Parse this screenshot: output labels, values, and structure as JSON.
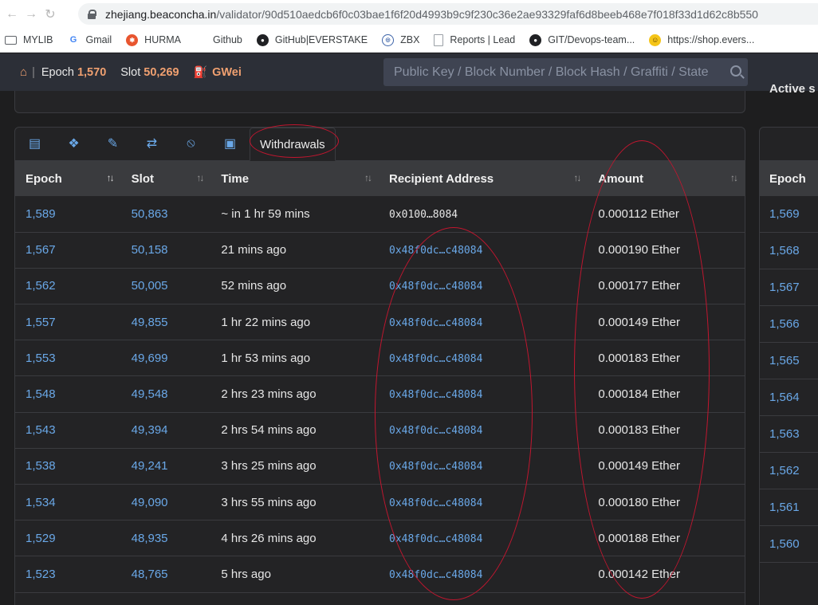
{
  "browser": {
    "url_host": "zhejiang.beaconcha.in",
    "url_path": "/validator/90d510aedcb6f0c03bae1f6f20d4993b9c9f230c36e2ae93329faf6d8beeb468e7f018f33d1d62c8b550"
  },
  "bookmarks": [
    {
      "label": "MYLIB",
      "icon": "folder-icon"
    },
    {
      "label": "Gmail",
      "icon": "google-icon"
    },
    {
      "label": "HURMA",
      "icon": "hurma-icon"
    },
    {
      "label": "Github",
      "icon": "none"
    },
    {
      "label": "GitHub|EVERSTAKE",
      "icon": "github-icon"
    },
    {
      "label": "ZBX",
      "icon": "zabbix-icon"
    },
    {
      "label": "Reports | Lead",
      "icon": "document-icon"
    },
    {
      "label": "GIT/Devops-team...",
      "icon": "github-icon"
    },
    {
      "label": "https://shop.evers...",
      "icon": "smiley-icon"
    }
  ],
  "navbar": {
    "epoch_label": "Epoch",
    "epoch_value": "1,570",
    "slot_label": "Slot",
    "slot_value": "50,269",
    "gas_label": "GWei",
    "search_placeholder": "Public Key / Block Number / Block Hash / Graffiti / State"
  },
  "right_panel": {
    "top_text": "Active s",
    "header": "Epoch",
    "epochs": [
      "1,569",
      "1,568",
      "1,567",
      "1,566",
      "1,565",
      "1,564",
      "1,563",
      "1,562",
      "1,561",
      "1,560"
    ]
  },
  "tabs": {
    "icons": [
      "bar-chart-icon",
      "cubes-icon",
      "chart-edit-icon",
      "sync-icon",
      "user-slash-icon",
      "wallet-icon"
    ],
    "active_label": "Withdrawals"
  },
  "table": {
    "columns": [
      "Epoch",
      "Slot",
      "Time",
      "Recipient Address",
      "Amount"
    ],
    "rows": [
      {
        "epoch": "1,589",
        "slot": "50,863",
        "time": "~ in 1 hr 59 mins",
        "address": "0x0100…8084",
        "amount": "0.000112 Ether"
      },
      {
        "epoch": "1,567",
        "slot": "50,158",
        "time": "21 mins ago",
        "address": "0x48f0dc…c48084",
        "amount": "0.000190 Ether"
      },
      {
        "epoch": "1,562",
        "slot": "50,005",
        "time": "52 mins ago",
        "address": "0x48f0dc…c48084",
        "amount": "0.000177 Ether"
      },
      {
        "epoch": "1,557",
        "slot": "49,855",
        "time": "1 hr 22 mins ago",
        "address": "0x48f0dc…c48084",
        "amount": "0.000149 Ether"
      },
      {
        "epoch": "1,553",
        "slot": "49,699",
        "time": "1 hr 53 mins ago",
        "address": "0x48f0dc…c48084",
        "amount": "0.000183 Ether"
      },
      {
        "epoch": "1,548",
        "slot": "49,548",
        "time": "2 hrs 23 mins ago",
        "address": "0x48f0dc…c48084",
        "amount": "0.000184 Ether"
      },
      {
        "epoch": "1,543",
        "slot": "49,394",
        "time": "2 hrs 54 mins ago",
        "address": "0x48f0dc…c48084",
        "amount": "0.000183 Ether"
      },
      {
        "epoch": "1,538",
        "slot": "49,241",
        "time": "3 hrs 25 mins ago",
        "address": "0x48f0dc…c48084",
        "amount": "0.000149 Ether"
      },
      {
        "epoch": "1,534",
        "slot": "49,090",
        "time": "3 hrs 55 mins ago",
        "address": "0x48f0dc…c48084",
        "amount": "0.000180 Ether"
      },
      {
        "epoch": "1,529",
        "slot": "48,935",
        "time": "4 hrs 26 mins ago",
        "address": "0x48f0dc…c48084",
        "amount": "0.000188 Ether"
      },
      {
        "epoch": "1,523",
        "slot": "48,765",
        "time": "5 hrs ago",
        "address": "0x48f0dc…c48084",
        "amount": "0.000142 Ether"
      }
    ]
  },
  "colors": {
    "accent_orange": "#f0a070",
    "link_blue": "#6aa8e8",
    "annotation_red": "#c2162f"
  }
}
